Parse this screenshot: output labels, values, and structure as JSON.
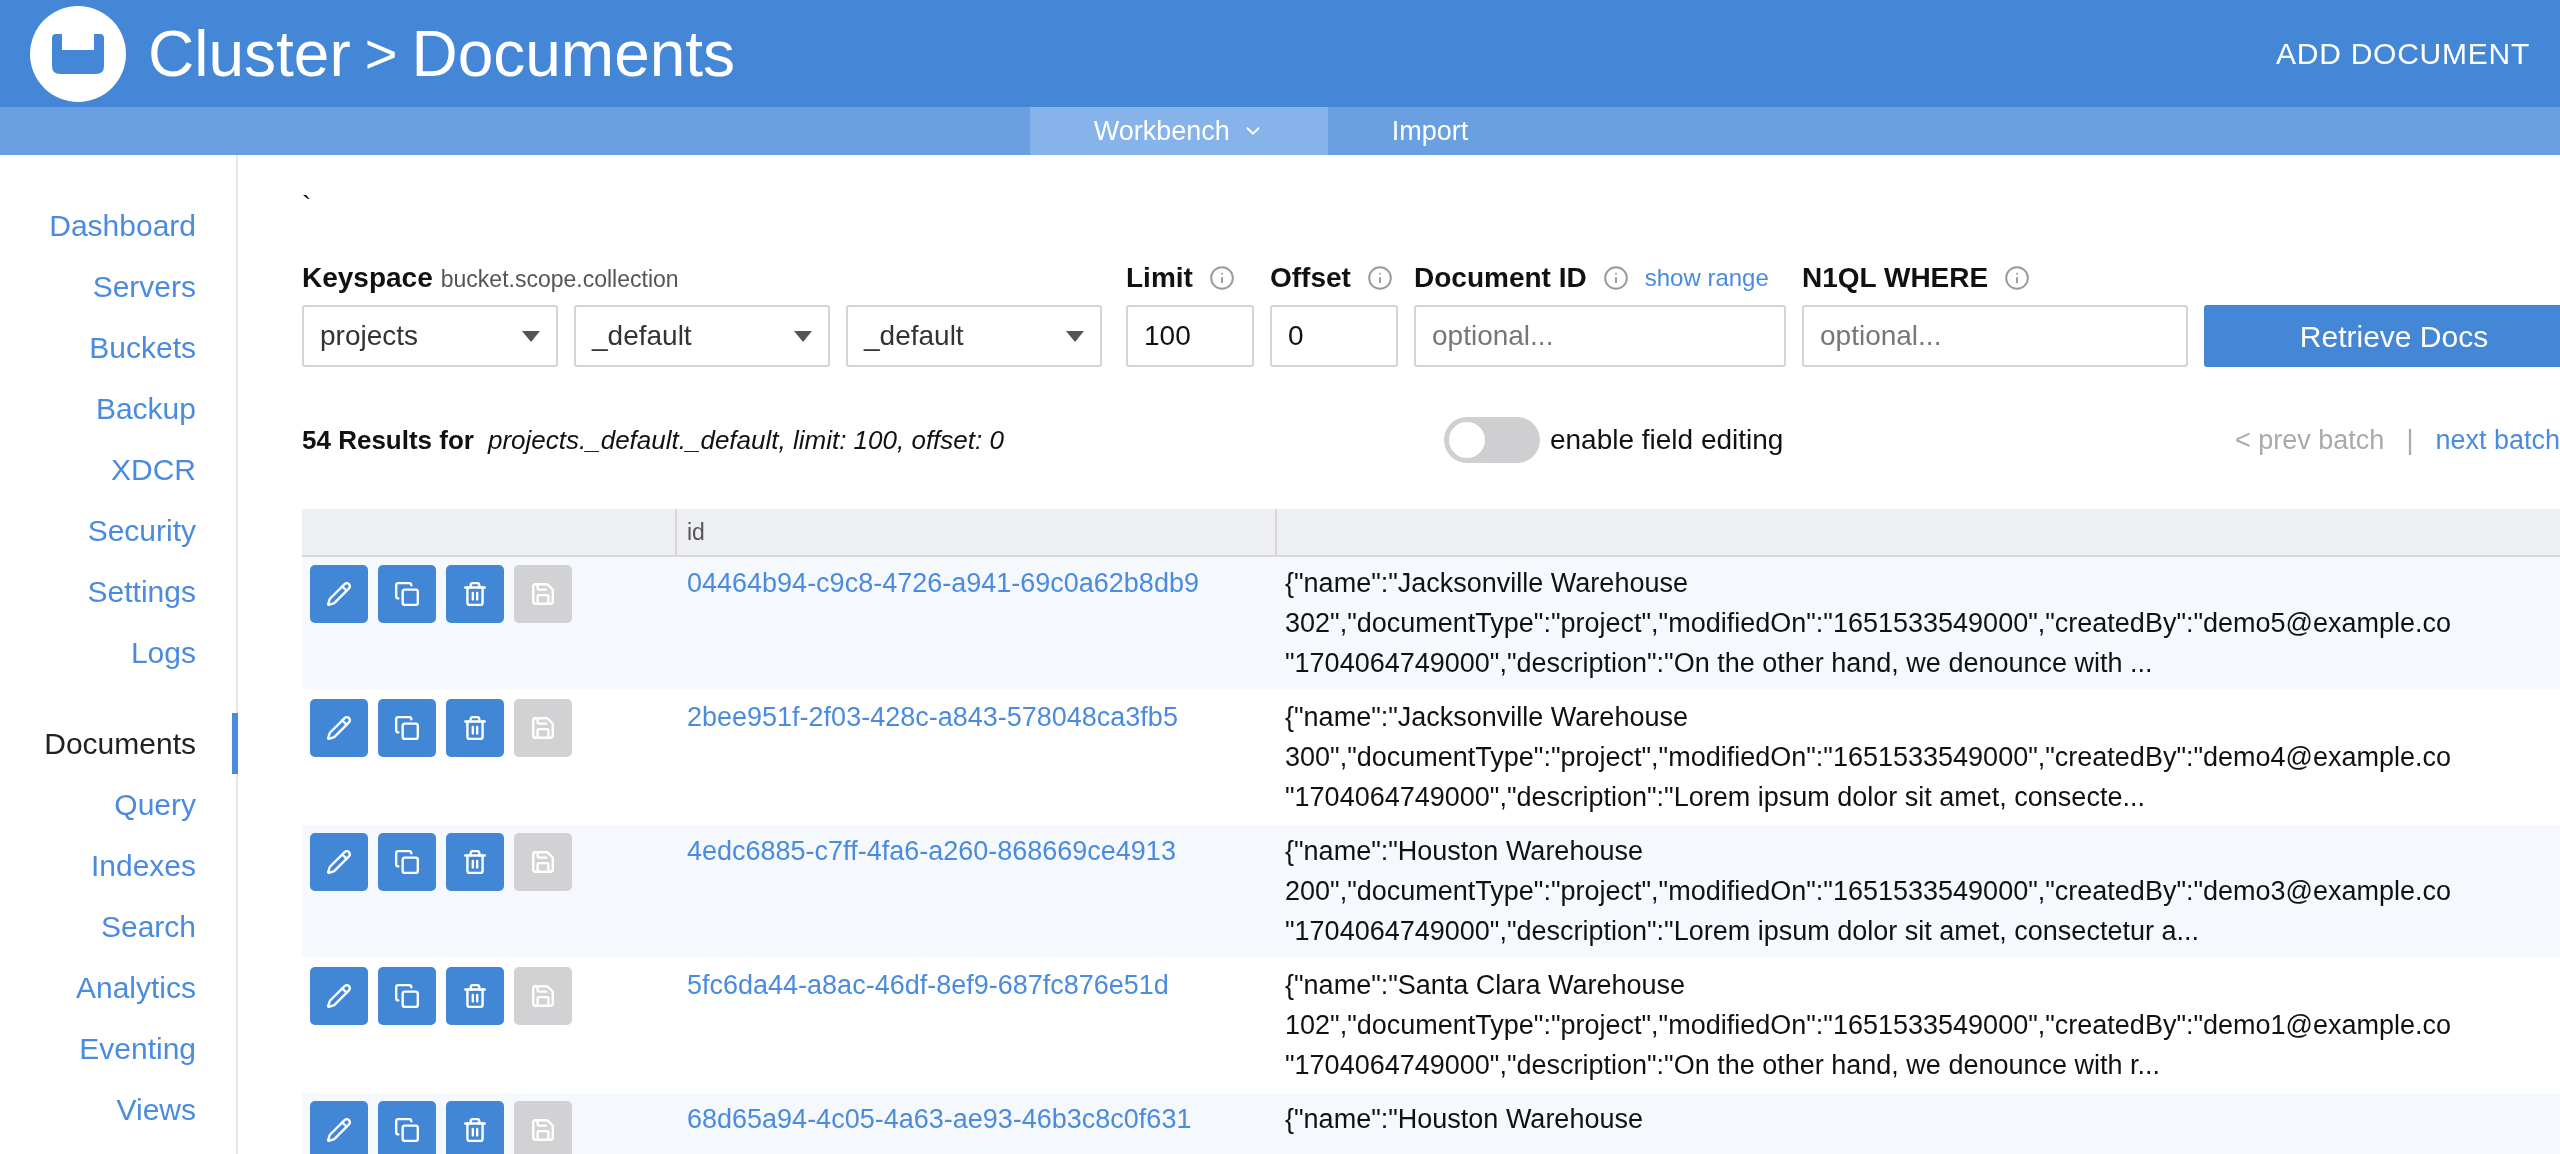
{
  "header": {
    "title": "Cluster",
    "separator": ">",
    "subtitle": "Documents",
    "action": "ADD DOCUMENT"
  },
  "subnav": [
    {
      "label": "Workbench",
      "selected": true,
      "dropdown": true
    },
    {
      "label": "Import",
      "selected": false,
      "dropdown": false
    }
  ],
  "sidebar": {
    "groups": [
      [
        {
          "label": "Dashboard",
          "selected": false
        },
        {
          "label": "Servers",
          "selected": false
        },
        {
          "label": "Buckets",
          "selected": false
        },
        {
          "label": "Backup",
          "selected": false
        },
        {
          "label": "XDCR",
          "selected": false
        },
        {
          "label": "Security",
          "selected": false
        },
        {
          "label": "Settings",
          "selected": false
        },
        {
          "label": "Logs",
          "selected": false
        }
      ],
      [
        {
          "label": "Documents",
          "selected": true
        },
        {
          "label": "Query",
          "selected": false
        },
        {
          "label": "Indexes",
          "selected": false
        },
        {
          "label": "Search",
          "selected": false
        },
        {
          "label": "Analytics",
          "selected": false
        },
        {
          "label": "Eventing",
          "selected": false
        },
        {
          "label": "Views",
          "selected": false
        }
      ]
    ]
  },
  "stray_mark": "`",
  "form": {
    "keyspace_label": "Keyspace",
    "keyspace_hint": "bucket.scope.collection",
    "selects": [
      "projects",
      "_default",
      "_default"
    ],
    "limit": {
      "label": "Limit",
      "value": "100"
    },
    "offset": {
      "label": "Offset",
      "value": "0"
    },
    "document_id": {
      "label": "Document ID",
      "link": "show range",
      "placeholder": "optional..."
    },
    "where": {
      "label": "N1QL WHERE",
      "placeholder": "optional..."
    },
    "submit": "Retrieve Docs"
  },
  "results": {
    "count": "54 Results for",
    "query": "projects._default._default, limit: 100, offset: 0"
  },
  "field_editing": {
    "label": "enable field editing",
    "on": false
  },
  "pagination": {
    "prev": {
      "label": "< prev batch",
      "disabled": true
    },
    "separator": "|",
    "next": {
      "label": "next batch",
      "disabled": false
    }
  },
  "table": {
    "columns": [
      "",
      "id",
      ""
    ],
    "rows": [
      {
        "id": "04464b94-c9c8-4726-a941-69c0a62b8db9",
        "save_disabled": true,
        "json": [
          "{\"name\":\"Jacksonville Warehouse",
          "302\",\"documentType\":\"project\",\"modifiedOn\":\"1651533549000\",\"createdBy\":\"demo5@example.co",
          "\"1704064749000\",\"description\":\"On the other hand, we denounce with ..."
        ]
      },
      {
        "id": "2bee951f-2f03-428c-a843-578048ca3fb5",
        "save_disabled": true,
        "json": [
          "{\"name\":\"Jacksonville Warehouse",
          "300\",\"documentType\":\"project\",\"modifiedOn\":\"1651533549000\",\"createdBy\":\"demo4@example.co",
          "\"1704064749000\",\"description\":\"Lorem ipsum dolor sit amet, consecte..."
        ]
      },
      {
        "id": "4edc6885-c7ff-4fa6-a260-868669ce4913",
        "save_disabled": true,
        "json": [
          "{\"name\":\"Houston Warehouse",
          "200\",\"documentType\":\"project\",\"modifiedOn\":\"1651533549000\",\"createdBy\":\"demo3@example.co",
          "\"1704064749000\",\"description\":\"Lorem ipsum dolor sit amet, consectetur a..."
        ]
      },
      {
        "id": "5fc6da44-a8ac-46df-8ef9-687fc876e51d",
        "save_disabled": true,
        "json": [
          "{\"name\":\"Santa Clara Warehouse",
          "102\",\"documentType\":\"project\",\"modifiedOn\":\"1651533549000\",\"createdBy\":\"demo1@example.co",
          "\"1704064749000\",\"description\":\"On the other hand, we denounce with r..."
        ]
      },
      {
        "id": "68d65a94-4c05-4a63-ae93-46b3c8c0f631",
        "save_disabled": true,
        "json": [
          "{\"name\":\"Houston Warehouse"
        ]
      }
    ]
  }
}
